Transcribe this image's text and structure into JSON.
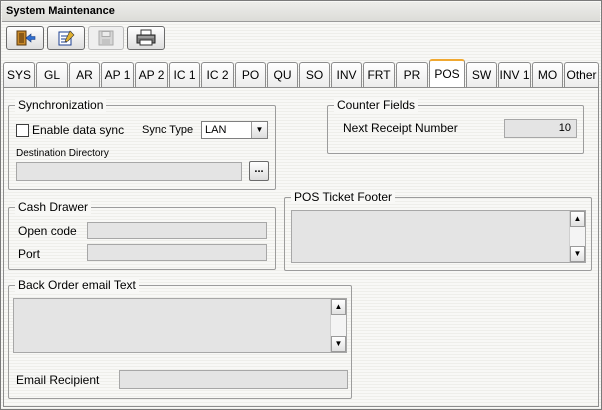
{
  "window": {
    "title": "System Maintenance"
  },
  "toolbar": {
    "buttons": [
      {
        "icon": "exit-door-icon",
        "enabled": true
      },
      {
        "icon": "edit-notepad-icon",
        "enabled": true
      },
      {
        "icon": "save-floppy-icon",
        "enabled": false
      },
      {
        "icon": "printer-icon",
        "enabled": true
      }
    ]
  },
  "tabs": [
    {
      "label": "SYS"
    },
    {
      "label": "GL"
    },
    {
      "label": "AR"
    },
    {
      "label": "AP 1"
    },
    {
      "label": "AP 2"
    },
    {
      "label": "IC 1"
    },
    {
      "label": "IC 2"
    },
    {
      "label": "PO"
    },
    {
      "label": "QU"
    },
    {
      "label": "SO"
    },
    {
      "label": "INV"
    },
    {
      "label": "FRT"
    },
    {
      "label": "PR"
    },
    {
      "label": "POS"
    },
    {
      "label": "SW"
    },
    {
      "label": "INV 1"
    },
    {
      "label": "MO"
    },
    {
      "label": "Other"
    }
  ],
  "active_tab": "POS",
  "synchronization": {
    "title": "Synchronization",
    "enable_label": "Enable data sync",
    "enable_checked": false,
    "sync_type_label": "Sync Type",
    "sync_type_value": "LAN",
    "dest_dir_label": "Destination Directory",
    "dest_dir_value": "",
    "browse_label": "..."
  },
  "counter_fields": {
    "title": "Counter Fields",
    "next_receipt_label": "Next Receipt Number",
    "next_receipt_value": "10"
  },
  "cash_drawer": {
    "title": "Cash Drawer",
    "open_code_label": "Open code",
    "open_code_value": "",
    "port_label": "Port",
    "port_value": ""
  },
  "pos_ticket_footer": {
    "title": "POS Ticket Footer",
    "text": ""
  },
  "back_order": {
    "title": "Back Order email Text",
    "text": "",
    "email_recipient_label": "Email Recipient",
    "email_recipient_value": ""
  }
}
